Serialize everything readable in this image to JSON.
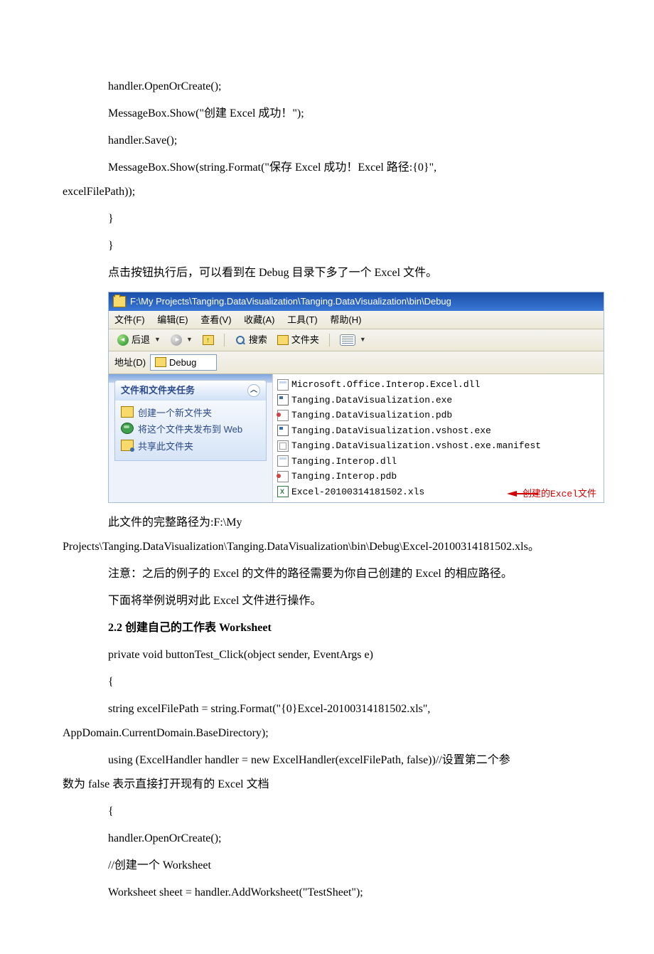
{
  "code_block_1": {
    "l1": "handler.OpenOrCreate();",
    "l2": "MessageBox.Show(\"创建 Excel 成功！\");",
    "l3": "handler.Save();",
    "l4": "MessageBox.Show(string.Format(\"保存 Excel 成功！Excel 路径:{0}\",",
    "l4b": "excelFilePath));",
    "l5": "}",
    "l6": "}"
  },
  "para1": "点击按钮执行后，可以看到在 Debug 目录下多了一个 Excel 文件。",
  "explorer": {
    "titlebar_path": "F:\\My Projects\\Tanging.DataVisualization\\Tanging.DataVisualization\\bin\\Debug",
    "menu": {
      "file": "文件(F)",
      "edit": "编辑(E)",
      "view": "查看(V)",
      "fav": "收藏(A)",
      "tools": "工具(T)",
      "help": "帮助(H)"
    },
    "toolbar": {
      "back": "后退",
      "search": "搜索",
      "folders": "文件夹"
    },
    "address_label": "地址(D)",
    "address_value": "Debug",
    "tasks": {
      "header": "文件和文件夹任务",
      "items": [
        "创建一个新文件夹",
        "将这个文件夹发布到 Web",
        "共享此文件夹"
      ]
    },
    "files": [
      {
        "icon": "dll",
        "name": "Microsoft.Office.Interop.Excel.dll"
      },
      {
        "icon": "exe",
        "name": "Tanging.DataVisualization.exe"
      },
      {
        "icon": "pdb",
        "name": "Tanging.DataVisualization.pdb"
      },
      {
        "icon": "exe",
        "name": "Tanging.DataVisualization.vshost.exe"
      },
      {
        "icon": "man",
        "name": "Tanging.DataVisualization.vshost.exe.manifest"
      },
      {
        "icon": "dll",
        "name": "Tanging.Interop.dll"
      },
      {
        "icon": "pdb",
        "name": "Tanging.Interop.pdb"
      },
      {
        "icon": "xls",
        "name": "Excel-20100314181502.xls"
      }
    ],
    "annotation": "创建的Excel文件"
  },
  "para2a": "此文件的完整路径为:F:\\My",
  "para2b": "Projects\\Tanging.DataVisualization\\Tanging.DataVisualization\\bin\\Debug\\Excel-20100314181502.xls。",
  "para3": "注意：之后的例子的 Excel 的文件的路径需要为你自己创建的 Excel 的相应路径。",
  "para4": "下面将举例说明对此 Excel 文件进行操作。",
  "heading22": "2.2 创建自己的工作表 Worksheet",
  "code_block_2": {
    "l1": "private void buttonTest_Click(object sender, EventArgs e)",
    "l2": "{",
    "l3": "string excelFilePath = string.Format(\"{0}Excel-20100314181502.xls\",",
    "l3b": "AppDomain.CurrentDomain.BaseDirectory);",
    "l4": "using (ExcelHandler handler = new ExcelHandler(excelFilePath, false))//设置第二个参",
    "l4b": "数为 false 表示直接打开现有的 Excel 文档",
    "l5": "{",
    "l6": "handler.OpenOrCreate();",
    "l7": "//创建一个 Worksheet",
    "l8": "Worksheet sheet = handler.AddWorksheet(\"TestSheet\");"
  }
}
